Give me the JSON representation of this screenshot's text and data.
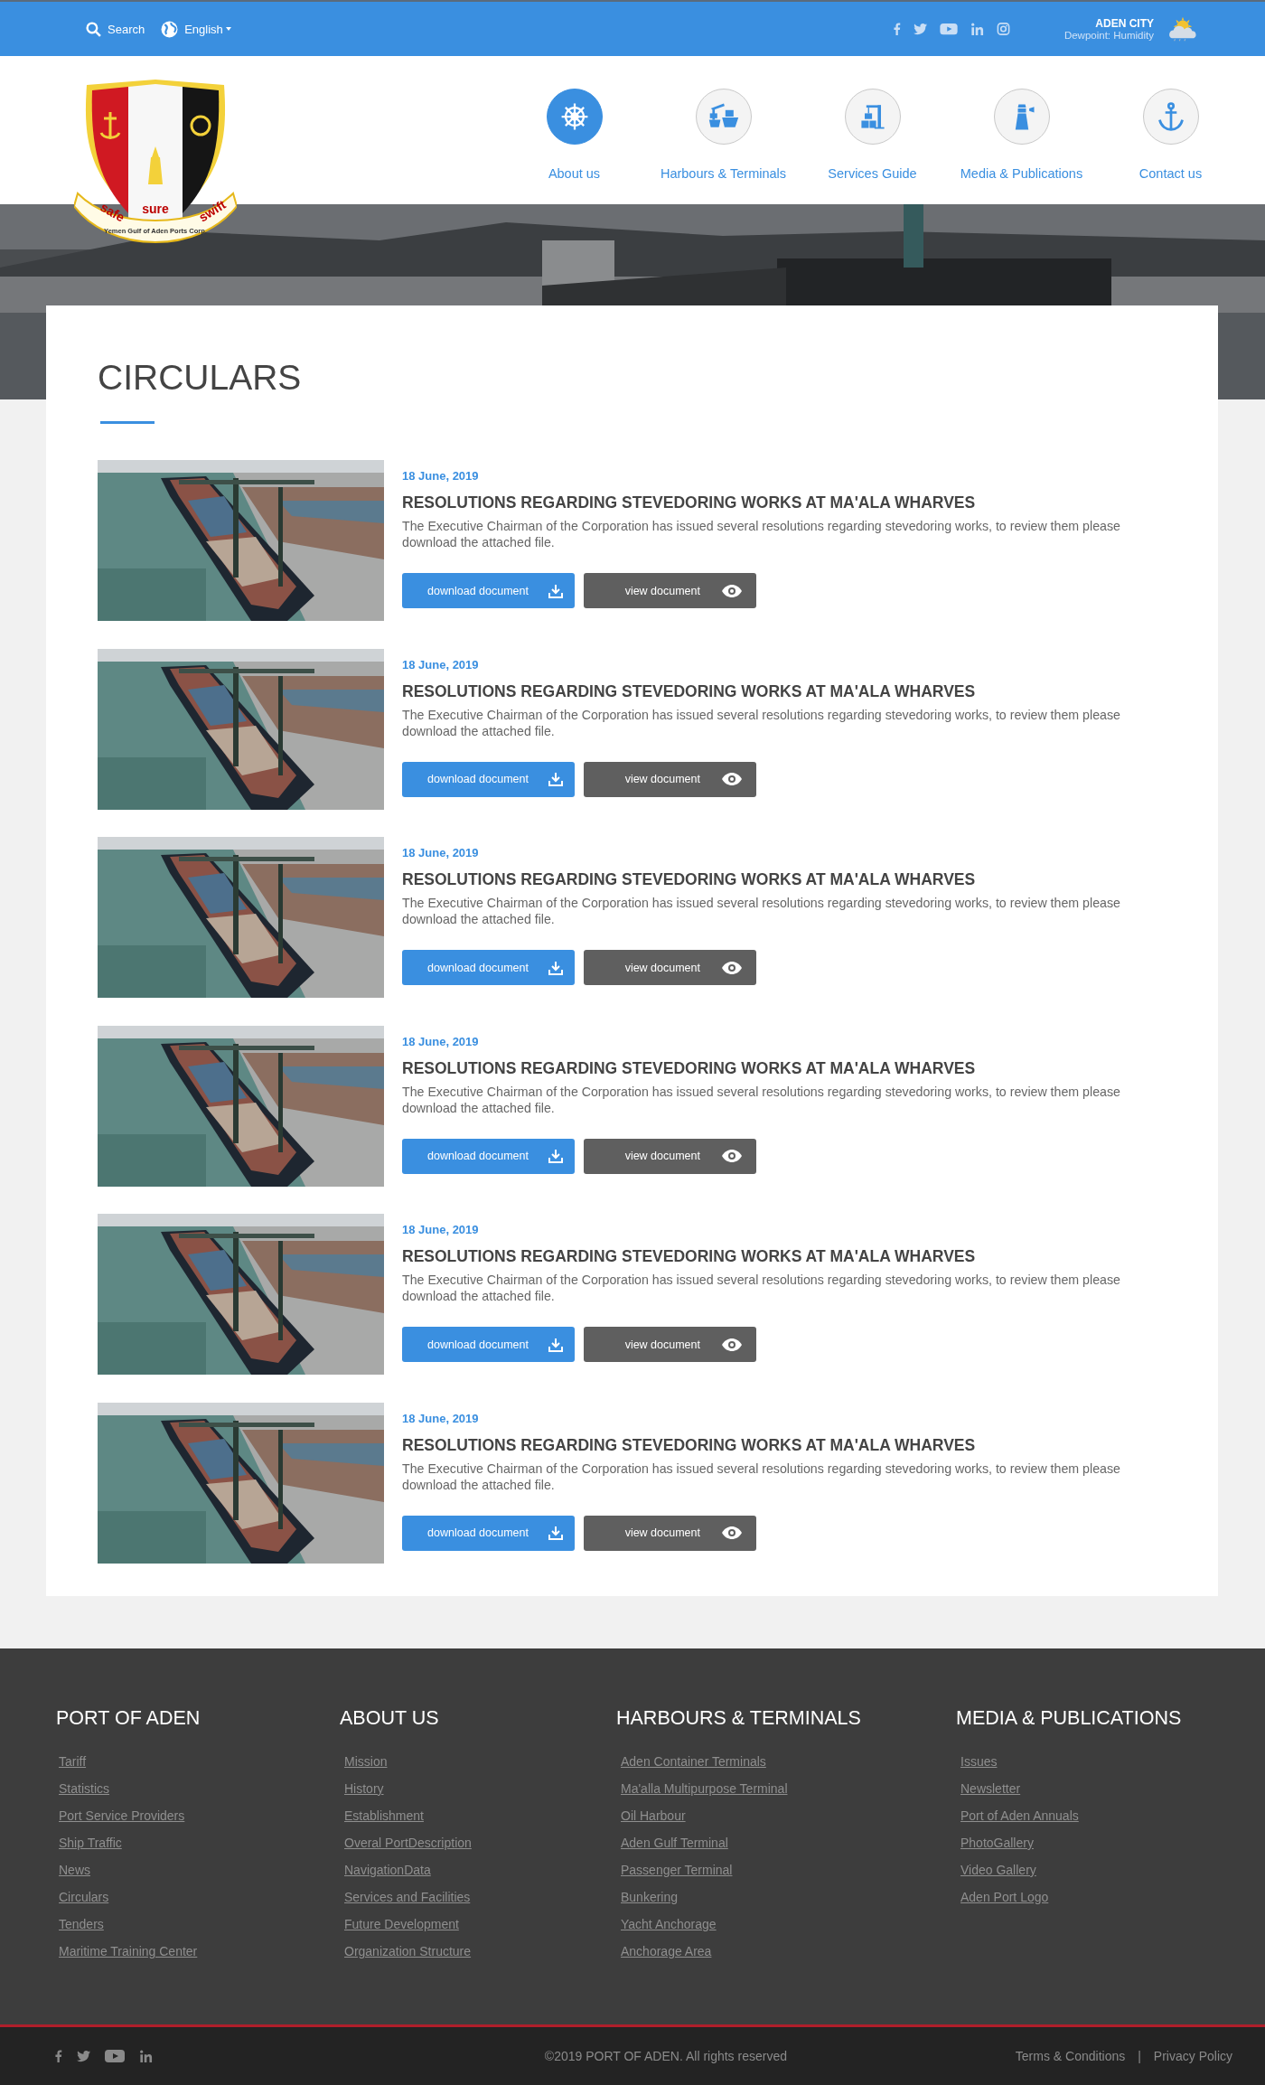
{
  "top_bar": {
    "search": "Search",
    "language": "English",
    "weather": {
      "city": "ADEN CITY",
      "dewpoint": "Dewpoint:",
      "humidity": "Humidity"
    }
  },
  "logo": {
    "mottos": [
      "safe",
      "sure",
      "swift"
    ],
    "name": "Yemen Gulf of Aden Ports Corp."
  },
  "nav": [
    {
      "label": "About us",
      "kind": "wheel",
      "selected": true
    },
    {
      "label": "Harbours & Terminals",
      "kind": "ship",
      "selected": false
    },
    {
      "label": "Services Guide",
      "kind": "crane",
      "selected": false
    },
    {
      "label": "Media & Publications",
      "kind": "lighthouse",
      "selected": false
    },
    {
      "label": "Contact us",
      "kind": "anchor",
      "selected": false
    }
  ],
  "page_title": "CIRCULARS",
  "circulars": [
    {
      "date": "18 June, 2019",
      "title": "RESOLUTIONS REGARDING STEVEDORING WORKS AT MA'ALA WHARVES",
      "description": "The Executive Chairman of the Corporation has issued several resolutions regarding stevedoring works, to review them please download the attached file.",
      "download": "download document",
      "view": "view document"
    },
    {
      "date": "18 June, 2019",
      "title": "RESOLUTIONS REGARDING STEVEDORING WORKS AT MA'ALA WHARVES",
      "description": "The Executive Chairman of the Corporation has issued several resolutions regarding stevedoring works, to review them please download the attached file.",
      "download": "download document",
      "view": "view document"
    },
    {
      "date": "18 June, 2019",
      "title": "RESOLUTIONS REGARDING STEVEDORING WORKS AT MA'ALA WHARVES",
      "description": "The Executive Chairman of the Corporation has issued several resolutions regarding stevedoring works, to review them please download the attached file.",
      "download": "download document",
      "view": "view document"
    },
    {
      "date": "18 June, 2019",
      "title": "RESOLUTIONS REGARDING STEVEDORING WORKS AT MA'ALA WHARVES",
      "description": "The Executive Chairman of the Corporation has issued several resolutions regarding stevedoring works, to review them please download the attached file.",
      "download": "download document",
      "view": "view document"
    },
    {
      "date": "18 June, 2019",
      "title": "RESOLUTIONS REGARDING STEVEDORING WORKS AT MA'ALA WHARVES",
      "description": "The Executive Chairman of the Corporation has issued several resolutions regarding stevedoring works, to review them please download the attached file.",
      "download": "download document",
      "view": "view document"
    },
    {
      "date": "18 June, 2019",
      "title": "RESOLUTIONS REGARDING STEVEDORING WORKS AT MA'ALA WHARVES",
      "description": "The Executive Chairman of the Corporation has issued several resolutions regarding stevedoring works, to review them please download the attached file.",
      "download": "download document",
      "view": "view document"
    }
  ],
  "footer": {
    "columns": [
      {
        "heading": "PORT OF ADEN",
        "links": [
          "Tariff",
          "Statistics",
          "Port Service Providers",
          "Ship Traffic",
          "News",
          "Circulars",
          "Tenders",
          "Maritime Training Center"
        ]
      },
      {
        "heading": "ABOUT US",
        "links": [
          "Mission",
          "History",
          "Establishment",
          "Overal PortDescription",
          "NavigationData",
          "Services and Facilities",
          "Future Development",
          "Organization Structure"
        ]
      },
      {
        "heading": "HARBOURS & TERMINALS",
        "links": [
          "Aden Container Terminals",
          "Ma'alla Multipurpose Terminal",
          "Oil Harbour",
          "Aden Gulf Terminal",
          "Passenger Terminal",
          "Bunkering",
          "Yacht Anchorage",
          "Anchorage Area"
        ]
      },
      {
        "heading": "MEDIA & PUBLICATIONS",
        "links": [
          "Issues",
          "Newsletter",
          "Port of Aden Annuals",
          "PhotoGallery",
          "Video Gallery",
          "Aden Port Logo"
        ]
      }
    ]
  },
  "bottom_bar": {
    "copyright": "©2019 PORT OF ADEN. All rights reserved",
    "links": [
      "Terms & Conditions",
      "Privacy Policy"
    ],
    "separator": "|"
  }
}
